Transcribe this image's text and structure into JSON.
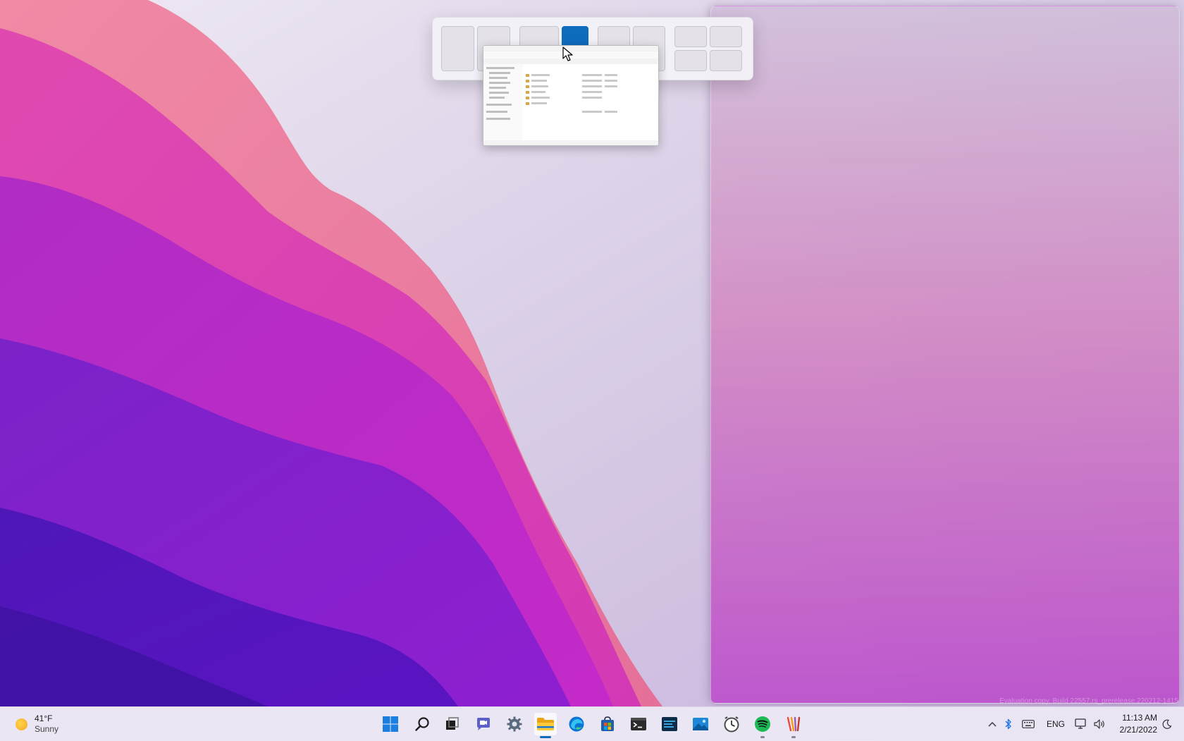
{
  "desktop": {
    "snap_layouts": {
      "groups": [
        {
          "name": "half-half"
        },
        {
          "name": "two-thirds-one-third"
        },
        {
          "name": "three-column"
        },
        {
          "name": "quad"
        }
      ]
    },
    "watermark": "Evaluation copy. Build 22557.rs_prerelease.220212-1415"
  },
  "taskbar": {
    "weather": {
      "temp": "41°F",
      "condition": "Sunny",
      "icon": "sun-icon"
    },
    "apps": [
      {
        "name": "start-button",
        "icon": "windows-logo-icon"
      },
      {
        "name": "search-button",
        "icon": "search-icon"
      },
      {
        "name": "task-view-button",
        "icon": "task-view-icon"
      },
      {
        "name": "teams-chat-button",
        "icon": "chat-icon"
      },
      {
        "name": "settings-app",
        "icon": "gear-icon"
      },
      {
        "name": "file-explorer-app",
        "icon": "folder-icon",
        "active": true
      },
      {
        "name": "edge-app",
        "icon": "edge-icon"
      },
      {
        "name": "store-app",
        "icon": "store-icon"
      },
      {
        "name": "terminal-app",
        "icon": "terminal-icon"
      },
      {
        "name": "generic-app",
        "icon": "app-tile-icon"
      },
      {
        "name": "photos-app",
        "icon": "photos-icon"
      },
      {
        "name": "clock-app",
        "icon": "clock-icon"
      },
      {
        "name": "spotify-app",
        "icon": "spotify-icon"
      },
      {
        "name": "paint-app",
        "icon": "paint-icon"
      }
    ],
    "tray": {
      "overflow_icon": "chevron-up-icon",
      "bluetooth_icon": "bluetooth-icon",
      "keyboard_icon": "keyboard-icon",
      "language": "ENG",
      "network_icon": "network-icon",
      "volume_icon": "volume-icon",
      "time": "11:13 AM",
      "date": "2/21/2022",
      "focus_icon": "moon-icon"
    }
  }
}
